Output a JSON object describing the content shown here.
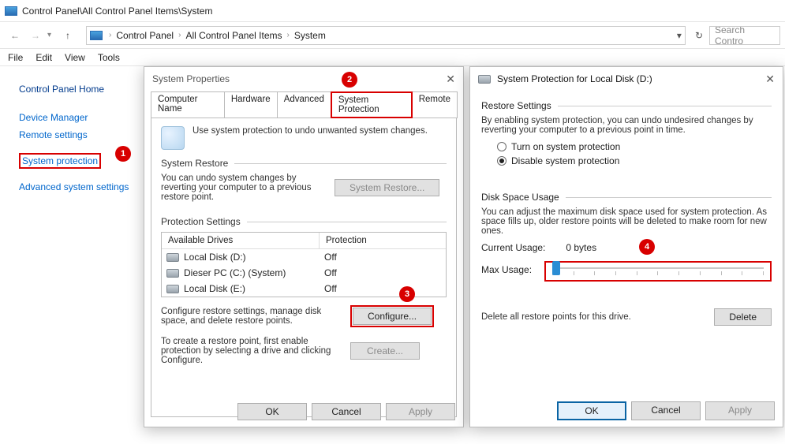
{
  "titlebar": {
    "path": "Control Panel\\All Control Panel Items\\System"
  },
  "breadcrumbs": {
    "a": "Control Panel",
    "b": "All Control Panel Items",
    "c": "System"
  },
  "search": {
    "placeholder": "Search Contro"
  },
  "menu": {
    "file": "File",
    "edit": "Edit",
    "view": "View",
    "tools": "Tools"
  },
  "sidebar": {
    "home": "Control Panel Home",
    "device": "Device Manager",
    "remote": "Remote settings",
    "protection": "System protection",
    "advanced": "Advanced system settings"
  },
  "markers": {
    "m1": "1",
    "m2": "2",
    "m3": "3",
    "m4": "4"
  },
  "dlg1": {
    "title": "System Properties",
    "tabs": {
      "cn": "Computer Name",
      "hw": "Hardware",
      "adv": "Advanced",
      "sp": "System Protection",
      "rm": "Remote"
    },
    "intro": "Use system protection to undo unwanted system changes.",
    "grp_restore": "System Restore",
    "restore_txt": "You can undo system changes by reverting your computer to a previous restore point.",
    "btn_restore": "System Restore...",
    "grp_prot": "Protection Settings",
    "col1": "Available Drives",
    "col2": "Protection",
    "drives": [
      {
        "name": "Local Disk (D:)",
        "state": "Off"
      },
      {
        "name": "Dieser PC (C:) (System)",
        "state": "Off"
      },
      {
        "name": "Local Disk (E:)",
        "state": "Off"
      }
    ],
    "conf_txt": "Configure restore settings, manage disk space, and delete restore points.",
    "btn_conf": "Configure...",
    "create_txt": "To create a restore point, first enable protection by selecting a drive and clicking Configure.",
    "btn_create": "Create...",
    "ok": "OK",
    "cancel": "Cancel",
    "apply": "Apply"
  },
  "dlg2": {
    "title": "System Protection for Local Disk (D:)",
    "grp_rs": "Restore Settings",
    "rs_txt": "By enabling system protection, you can undo undesired changes by reverting your computer to a previous point in time.",
    "opt_on": "Turn on system protection",
    "opt_off": "Disable system protection",
    "grp_du": "Disk Space Usage",
    "du_txt": "You can adjust the maximum disk space used for system protection. As space fills up, older restore points will be deleted to make room for new ones.",
    "cur_label": "Current Usage:",
    "cur_val": "0 bytes",
    "max_label": "Max Usage:",
    "del_txt": "Delete all restore points for this drive.",
    "btn_del": "Delete",
    "ok": "OK",
    "cancel": "Cancel",
    "apply": "Apply"
  }
}
